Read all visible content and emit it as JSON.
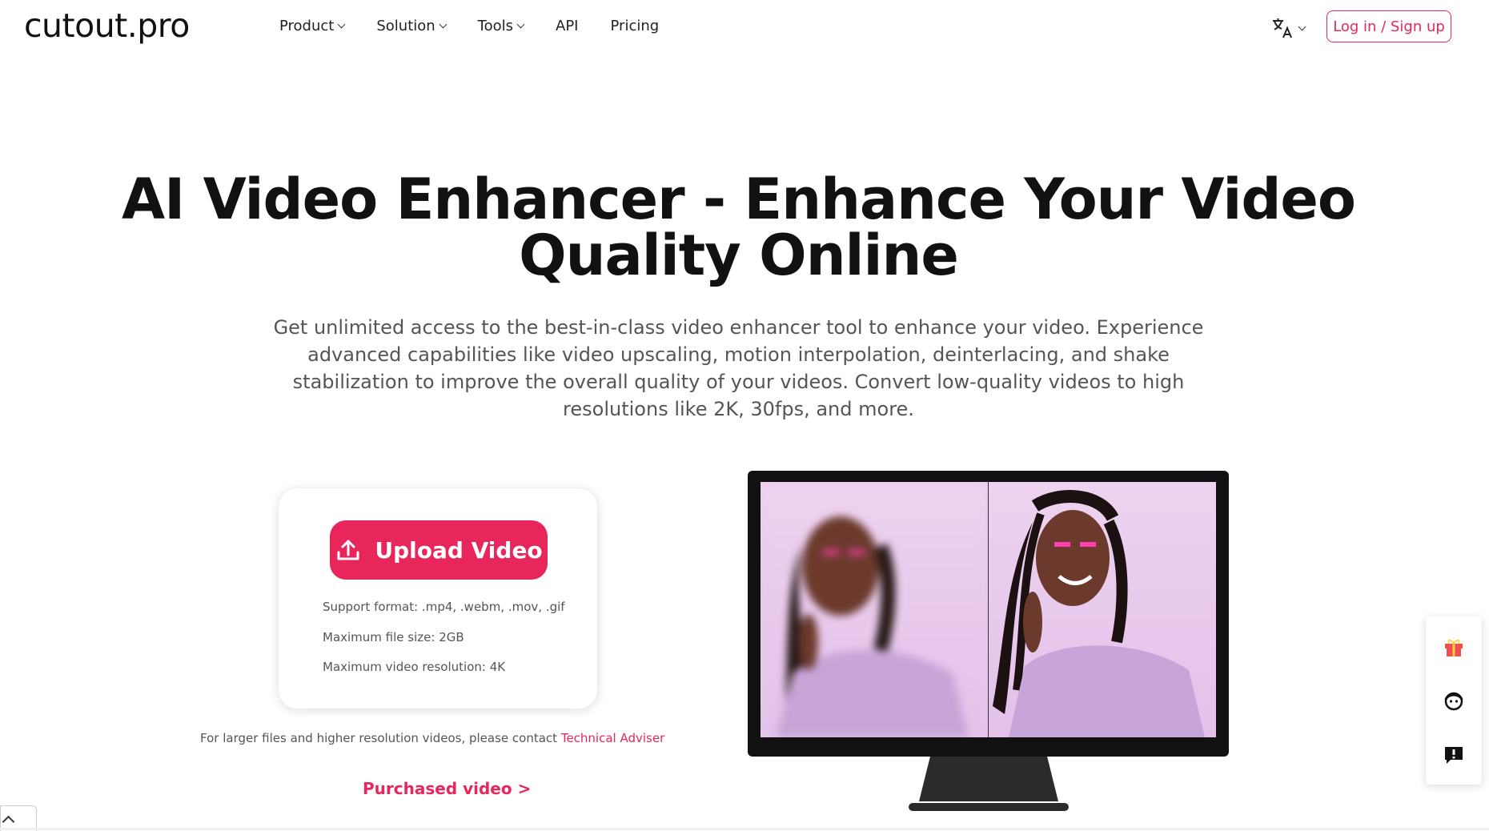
{
  "nav": {
    "logo": "cutout.pro",
    "items": [
      {
        "label": "Product",
        "dropdown": true
      },
      {
        "label": "Solution",
        "dropdown": true
      },
      {
        "label": "Tools",
        "dropdown": true
      },
      {
        "label": "API",
        "dropdown": false
      },
      {
        "label": "Pricing",
        "dropdown": false
      }
    ],
    "language_icon": "translate-icon",
    "login_label": "Log in / Sign up"
  },
  "hero": {
    "title_line1": "AI Video Enhancer - Enhance Your Video",
    "title_line2": "Quality Online",
    "description": "Get unlimited access to the best-in-class video enhancer tool to enhance your video. Experience advanced capabilities like video upscaling, motion interpolation, deinterlacing, and shake stabilization to improve the overall quality of your videos. Convert low-quality videos to high resolutions like 2K, 30fps, and more."
  },
  "upload": {
    "button_label": "Upload Video",
    "support_format": "Support format: .mp4, .webm, .mov, .gif",
    "max_size": "Maximum file size: 2GB",
    "max_resolution": "Maximum video resolution: 4K",
    "contact_text": "For larger files and higher resolution videos, please contact ",
    "contact_link": "Technical Adviser",
    "purchased_label": "Purchased video >"
  },
  "side_panel": {
    "icons": [
      "gift-icon",
      "support-agent-icon",
      "feedback-icon"
    ]
  },
  "colors": {
    "accent": "#e8265c",
    "text": "#111111",
    "muted": "#555555"
  }
}
